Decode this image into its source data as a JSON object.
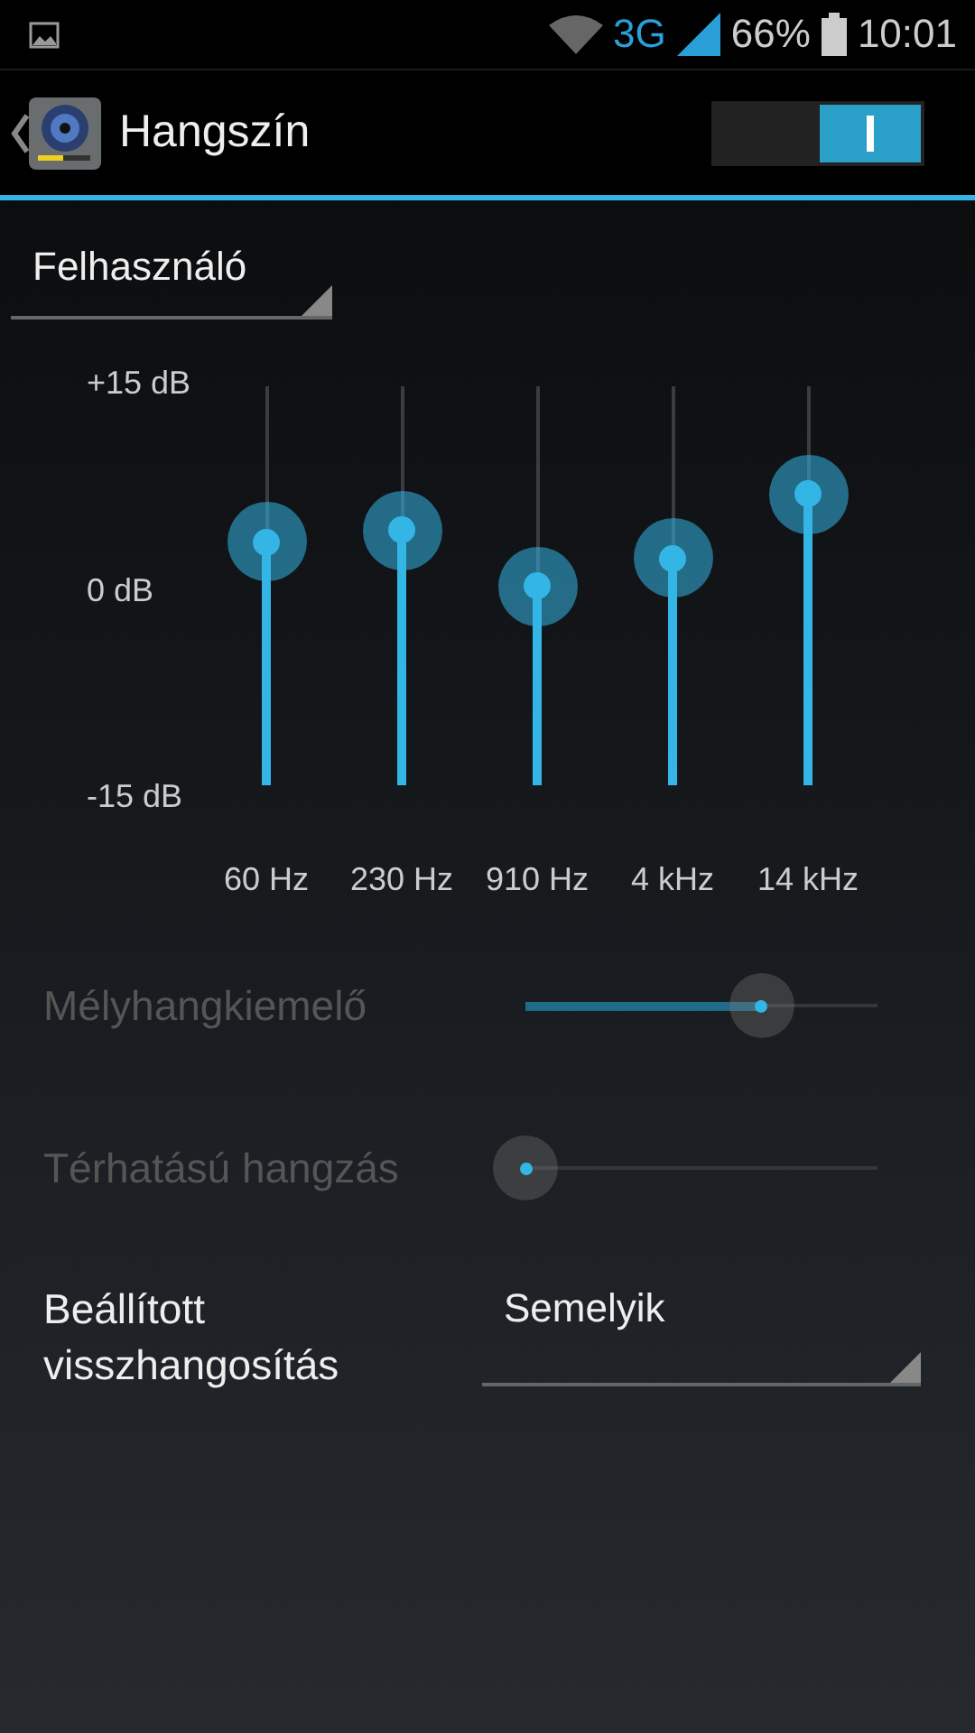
{
  "status_bar": {
    "network": "3G",
    "battery": "66%",
    "time": "10:01"
  },
  "action_bar": {
    "title": "Hangszín",
    "switch_on": true
  },
  "preset": {
    "value": "Felhasználó"
  },
  "equalizer": {
    "db_labels": [
      "+15 dB",
      "0 dB",
      "-15 dB"
    ],
    "bands": [
      {
        "label": "60 Hz",
        "level": 0.61
      },
      {
        "label": "230 Hz",
        "level": 0.64
      },
      {
        "label": "910 Hz",
        "level": 0.5
      },
      {
        "label": "4 kHz",
        "level": 0.57
      },
      {
        "label": "14 kHz",
        "level": 0.73
      }
    ]
  },
  "effects": [
    {
      "label": "Mélyhangkiemelő",
      "disabled": true,
      "level": 0.67
    },
    {
      "label": "Térhatású hangzás",
      "disabled": true
    }
  ],
  "reverb": {
    "label": "Beállított visszhangosítás",
    "value": "Semelyik"
  }
}
